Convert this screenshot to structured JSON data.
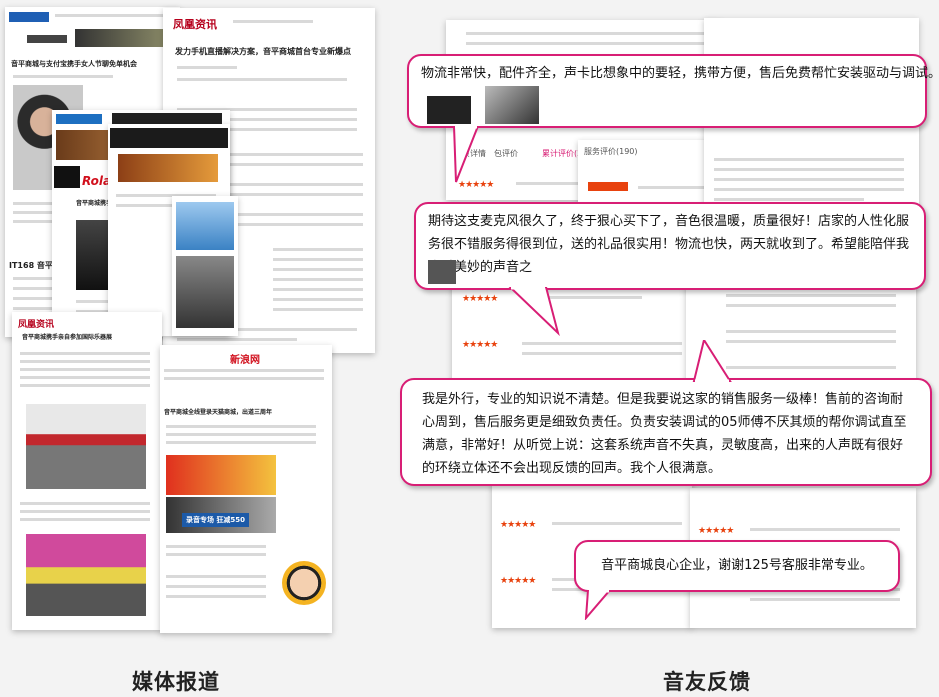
{
  "captions": {
    "media": "媒体报道",
    "feedback": "音友反馈"
  },
  "media": {
    "sheet1_title": "音平商城与支付宝携手女人节聊免单机会",
    "sheet2_title": "发力手机直播解决方案，音平商城首台专业新爆点",
    "sheet3_title": "IT168 音平商城获奖",
    "sheet4_title": "音平商城携手ROLAND 发布全新录音声卡",
    "sheet5_title": "音平商城携手亲自参加国际乐器展",
    "sheet6_title": "音平商城全线登录天猫商城，出道三周年",
    "brand_ifeng": "凤凰资讯",
    "brand_roland": "Roland",
    "brand_sina": "新浪网",
    "banner_text": "录音专场 狂减550"
  },
  "feedback": {
    "bubble1": "物流非常快，配件齐全，声卡比想象中的要轻，携带方便，售后免费帮忙安装驱动与调试。满意",
    "bubble2": "期待这支麦克风很久了，终于狠心买下了，音色很温暖，质量很好！店家的人性化服务很不错服务得很到位，送的礼品很实用！物流也快，两天就收到了。希望能陪伴我度过美妙的声音之",
    "bubble3": "我是外行，专业的知识说不清楚。但是我要说这家的销售服务一级棒！售前的咨询耐心周到，售后服务更是细致负责任。负责安装调试的05师傅不厌其烦的帮你调试直至满意，非常好！从听觉上说：这套系统声音不失真，灵敏度高，出来的人声既有很好的环绕立体还不会出现反馈的回声。我个人很满意。",
    "bubble4": "音平商城良心企业，谢谢125号客服非常专业。",
    "tabs": [
      "宝贝详情",
      "包评价",
      "累计评价(235)",
      "服务评价(190)"
    ],
    "stars": "★★★★★"
  },
  "colors": {
    "accent": "#d81e75",
    "star": "#e8420e"
  }
}
